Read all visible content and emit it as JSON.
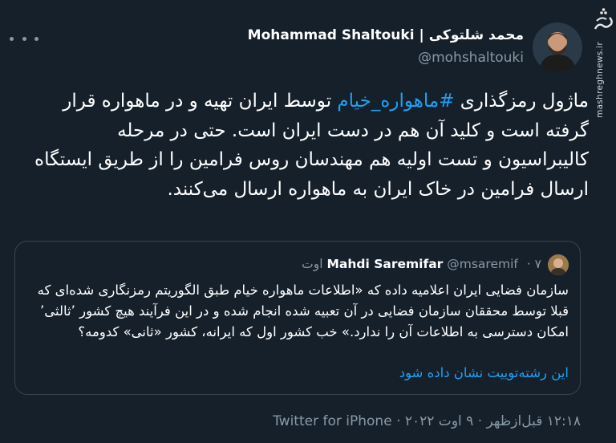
{
  "author": {
    "name_fa": "محمد شلتوکی",
    "separator": "|",
    "name_en": "Mohammad Shaltouki",
    "handle": "@mohshaltouki"
  },
  "watermark": {
    "logo_text": "مشرق",
    "url": "mashreghnews.ir"
  },
  "tweet": {
    "text_before": "ماژول رمزگذاری ",
    "hashtag": "#ماهواره_خیام",
    "text_after": " توسط ایران تهیه و در ماهواره قرار گرفته است و کلید آن هم در دست ایران است. حتی در مرحله کالیبراسیون و تست اولیه هم مهندسان روس فرامین را از طریق ایستگاه ارسال فرامین در خاک ایران به ماهواره ارسال می‌کنند."
  },
  "quoted": {
    "name": "Mahdi Saremifar",
    "handle": "@msaremif",
    "dot": "·",
    "time": "۷ اوت",
    "text": "سازمان فضایی ایران اعلامیه داده که «اطلاعات  ماهواره خیام طبق الگوریتم رمزنگاری شده‌ای که قبلا توسط محققان سازمان فضایی در آن تعبیه شده انجام شده و در این فرآیند هیچ کشور ’ثالثی’ امکان دسترسی به اطلاعات آن را ندارد.» خب کشور اول که ایرانه، کشور «ثانی» کدومه؟",
    "thread_link": "این رشته‌توییت نشان داده شود"
  },
  "footer": {
    "time": "۱۲:۱۸ قبل‌ازظهر",
    "dot1": "·",
    "date": "۹ اوت ۲۰۲۲",
    "dot2": "·",
    "source": "Twitter for iPhone"
  },
  "icons": {
    "more": "more-dots-icon",
    "verified": "none"
  },
  "colors": {
    "background": "#15202b",
    "text": "#ffffff",
    "secondary": "#8899a6",
    "accent": "#1da1f2",
    "border": "#38444d"
  }
}
